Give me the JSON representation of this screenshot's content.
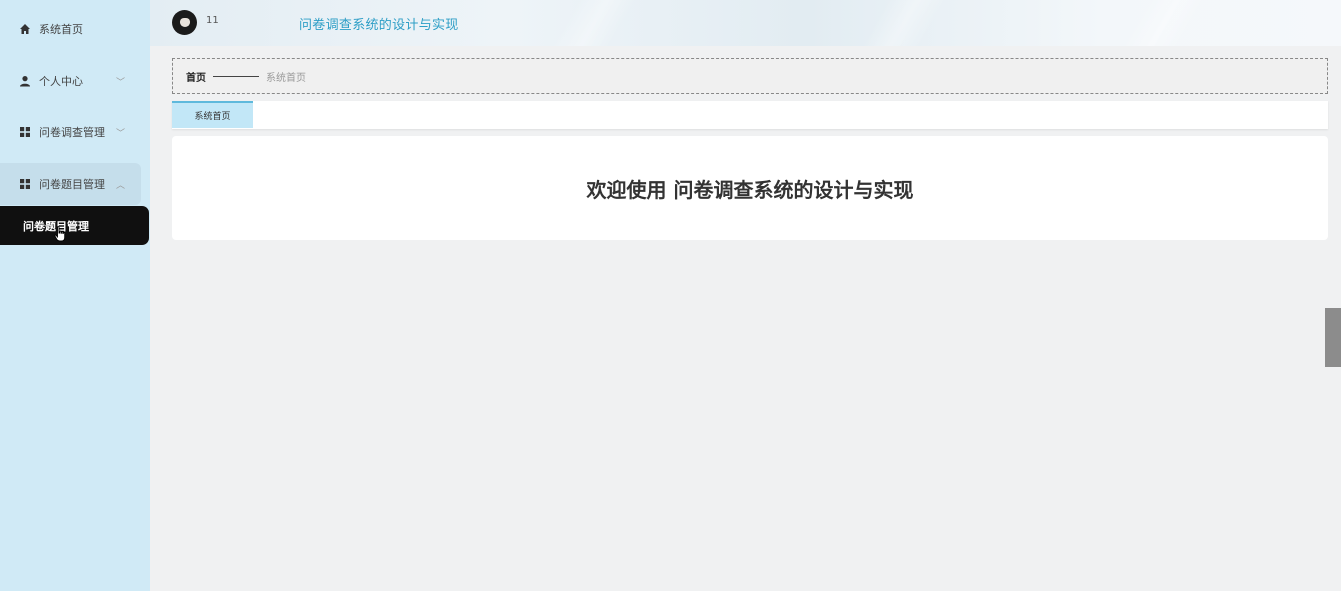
{
  "sidebar": {
    "items": [
      {
        "label": "系统首页",
        "icon": "home-icon"
      },
      {
        "label": "个人中心",
        "icon": "user-icon"
      },
      {
        "label": "问卷调查管理",
        "icon": "grid-icon"
      },
      {
        "label": "问卷题目管理",
        "icon": "grid-icon"
      }
    ],
    "submenu": {
      "label": "问卷题目管理"
    }
  },
  "header": {
    "username": "11",
    "title": "问卷调查系统的设计与实现"
  },
  "breadcrumb": {
    "home": "首页",
    "current": "系统首页"
  },
  "tabs": [
    {
      "label": "系统首页",
      "active": true
    }
  ],
  "main": {
    "welcome": "欢迎使用 问卷调查系统的设计与实现"
  },
  "colors": {
    "sidebar_bg": "#d0eaf6",
    "accent": "#2d9ec6",
    "submenu_active_bg": "#101010",
    "tab_active_bg": "#c2e7f7"
  }
}
